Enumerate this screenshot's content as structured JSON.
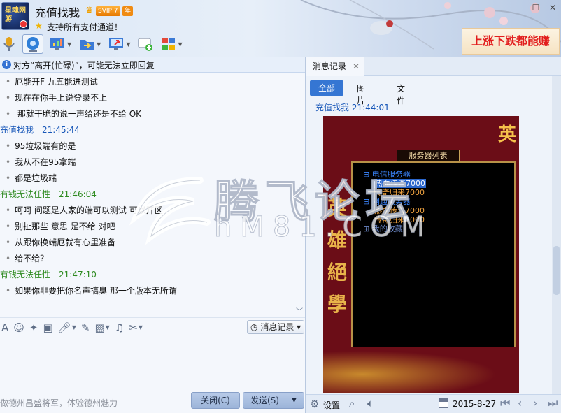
{
  "header": {
    "avatar_text": "星魂网游",
    "contact_name": "充值找我",
    "vip_level": "SVIP 7",
    "vip_year": "年",
    "signature": "支持所有支付通道！",
    "ad_banner": "上涨下跌都能赚",
    "win_min": "—",
    "win_max": "☐",
    "win_close": "✕"
  },
  "toolbar": {
    "items": [
      "voice-call-icon",
      "video-call-icon",
      "screen-share-icon",
      "send-file-icon",
      "remote-desktop-icon",
      "invite-icon",
      "app-grid-icon"
    ]
  },
  "notice": {
    "text": "对方“离开(忙碌)”，可能无法立即回复",
    "close": "✕"
  },
  "chat": {
    "messages": [
      {
        "type": "line",
        "text": "厄能开F 九五能进测试"
      },
      {
        "type": "line",
        "text": "现在在你手上说登录不上"
      },
      {
        "type": "line",
        "text": " 那就干脆的说一声给还是不给  OK"
      },
      {
        "type": "head",
        "sender": "充值找我",
        "time": "21:45:44",
        "color": "#1656b8"
      },
      {
        "type": "line",
        "text": "95垃圾端有的是"
      },
      {
        "type": "line",
        "text": "我从不在95拿端"
      },
      {
        "type": "line",
        "text": "都是垃圾端"
      },
      {
        "type": "head",
        "sender": "有钱无法任性",
        "time": "21:46:04",
        "color": "#2d8a1f"
      },
      {
        "type": "line",
        "text": "呵呵  问题是人家的端可以测试 可以开区"
      },
      {
        "type": "line",
        "text": "别扯那些 意思 是不给 对吧"
      },
      {
        "type": "line",
        "text": "从跟你换端厄就有心里准备"
      },
      {
        "type": "line",
        "text": "给不给？"
      },
      {
        "type": "head",
        "sender": "有钱无法任性",
        "time": "21:47:10",
        "color": "#2d8a1f"
      },
      {
        "type": "line",
        "text": "如果你非要把你名声搞臭 那一个版本无所谓"
      }
    ]
  },
  "input_toolbar": {
    "history_label": "消息记录",
    "history_caret": "▾"
  },
  "bottom": {
    "slogan": "做德州昌盛将军，体验德州魅力",
    "close_label": "关闭(C)",
    "send_label": "发送(S)",
    "send_caret": "▼"
  },
  "right": {
    "tab_label": "消息记录",
    "tab_close": "✕",
    "filter_all": "全部",
    "filter_images": "图片",
    "filter_files": "文件",
    "msg_sender": "充值找我",
    "msg_time": "21:44:01",
    "settings_label": "设置",
    "date": "2015-8-27",
    "nav": [
      "⏮",
      "‹",
      "›",
      "⏭"
    ]
  },
  "game": {
    "panel_title": "服务器列表",
    "tree": [
      {
        "kind": "cat",
        "text": "⊟ 电信服务器"
      },
      {
        "kind": "sel",
        "text": "热血传奇7000"
      },
      {
        "kind": "srv",
        "text": "传奇归来7000"
      },
      {
        "kind": "cat",
        "text": "⊟ 网通服务器"
      },
      {
        "kind": "srv",
        "text": "热血传奇7000"
      },
      {
        "kind": "srv",
        "text": "传奇归来7000"
      },
      {
        "kind": "sub",
        "text": "⊞ 我的收藏"
      }
    ],
    "side_chars": [
      "英",
      "雄",
      "絕",
      "學"
    ],
    "top_char": "英"
  },
  "watermark": {
    "cn": "腾飞论坛",
    "en": "hM81.COM"
  }
}
